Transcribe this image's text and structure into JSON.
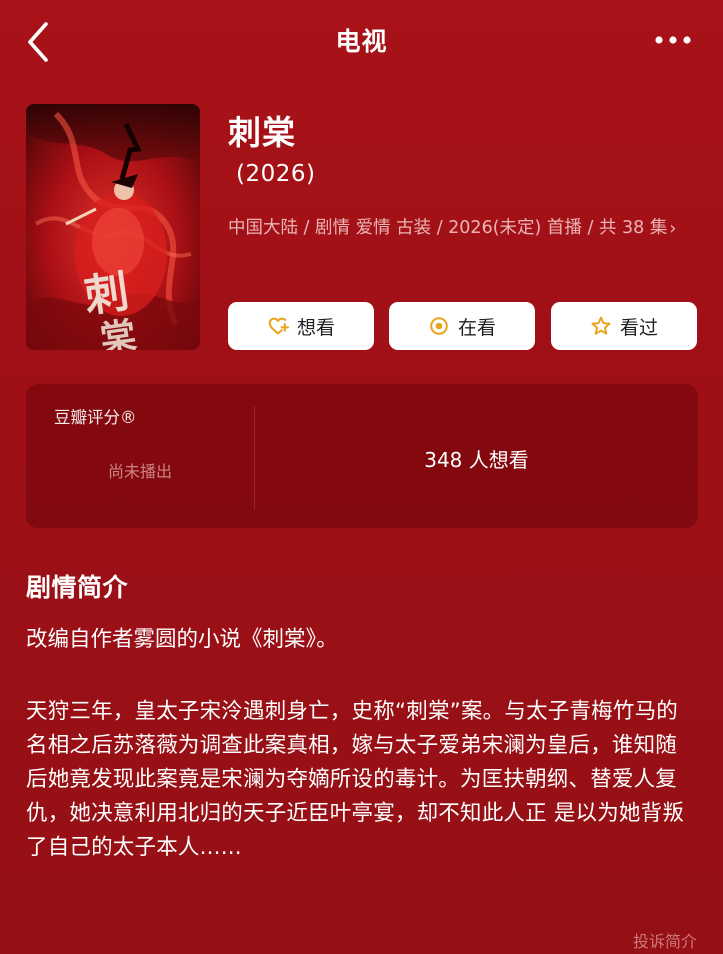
{
  "header": {
    "title": "电视",
    "back_icon": "chevron-left-icon",
    "more_icon": "more-horizontal-icon"
  },
  "show": {
    "title": "刺棠",
    "year": "(2026)",
    "meta": "中国大陆 / 剧情 爱情 古装 / 2026(未定) 首播 / 共 38 集",
    "meta_chevron": "›"
  },
  "actions": [
    {
      "label": "想看",
      "icon": "heart-plus-icon"
    },
    {
      "label": "在看",
      "icon": "target-circle-icon"
    },
    {
      "label": "看过",
      "icon": "star-icon"
    }
  ],
  "rating": {
    "label": "豆瓣评分®",
    "status": "尚未播出",
    "want_count": "348 人想看"
  },
  "synopsis": {
    "title": "剧情简介",
    "intro": "改编自作者雾圆的小说《刺棠》。",
    "body": "天狩三年，皇太子宋泠遇刺身亡，史称“刺棠”案。与太子青梅竹马的名相之后苏落薇为调查此案真相，嫁与太子爱弟宋澜为皇后，谁知随后她竟发现此案竟是宋澜为夺嫡所设的毒计。为匡扶朝纲、替爱人复仇，她决意利用北归的天子近臣叶亭宴，却不知此人正 是以为她背叛了自己的太子本人......",
    "report_label": "投诉简介"
  },
  "colors": {
    "background": "#a81218",
    "accent_gold": "#e9a318",
    "button_bg": "#ffffff"
  }
}
